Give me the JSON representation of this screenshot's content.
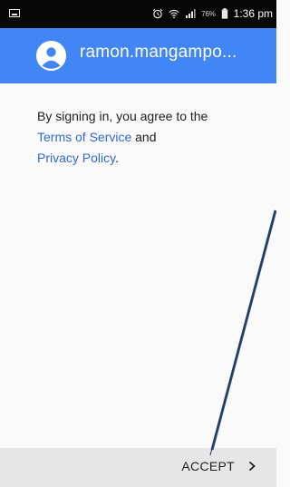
{
  "status_bar": {
    "battery_percent": "76%",
    "time": "1:36 pm",
    "icons": [
      "screenshot-icon",
      "alarm-icon",
      "wifi-icon",
      "signal-icon",
      "battery-icon"
    ]
  },
  "header": {
    "account_name": "ramon.mangampo...",
    "avatar_icon": "account-circle-icon",
    "background_color": "#4285f4"
  },
  "body": {
    "text_prefix": "By signing in, you agree to the",
    "terms_link": "Terms of Service",
    "joiner": "and",
    "privacy_link": "Privacy Policy",
    "suffix": ".",
    "link_color": "#3367d6"
  },
  "bottom_bar": {
    "accept_label": "ACCEPT",
    "chevron_icon": "chevron-right-icon"
  },
  "annotation": {
    "arrow_color": "#2f4a78",
    "arrow_icon": "annotation-arrow"
  }
}
